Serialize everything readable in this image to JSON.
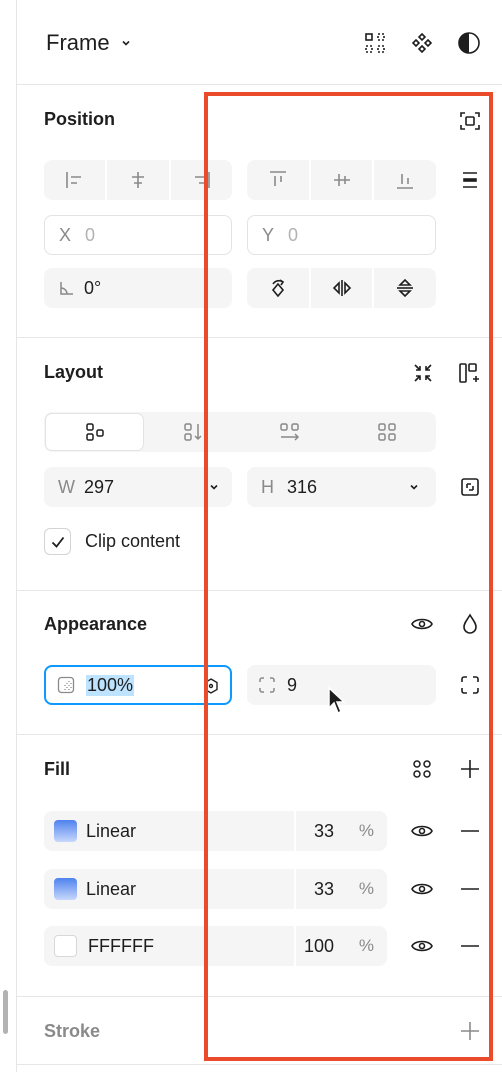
{
  "header": {
    "title": "Frame",
    "chevron_icon": "chevron-down-icon",
    "icons": [
      "grid-dashed-icon",
      "component-icon",
      "contrast-icon"
    ]
  },
  "position": {
    "title": "Position",
    "x_label": "X",
    "x_value": "0",
    "y_label": "Y",
    "y_value": "0",
    "rotation_value": "0°"
  },
  "layout": {
    "title": "Layout",
    "width_label": "W",
    "width_value": "297",
    "height_label": "H",
    "height_value": "316",
    "clip_content_label": "Clip content",
    "clip_content_checked": true
  },
  "appearance": {
    "title": "Appearance",
    "opacity_value": "100%",
    "radius_value": "9"
  },
  "fill": {
    "title": "Fill",
    "items": [
      {
        "type": "Linear",
        "opacity": "33",
        "unit": "%"
      },
      {
        "type": "Linear",
        "opacity": "33",
        "unit": "%"
      },
      {
        "type": "FFFFFF",
        "opacity": "100",
        "unit": "%"
      }
    ]
  },
  "stroke": {
    "title": "Stroke"
  },
  "colors": {
    "annotation_border": "#ea4b2a",
    "selection_blue": "#0d99ff",
    "selection_fill": "#bde3ff",
    "gradient_top": "#4f82ee",
    "gradient_bottom": "#c7d8fb"
  }
}
